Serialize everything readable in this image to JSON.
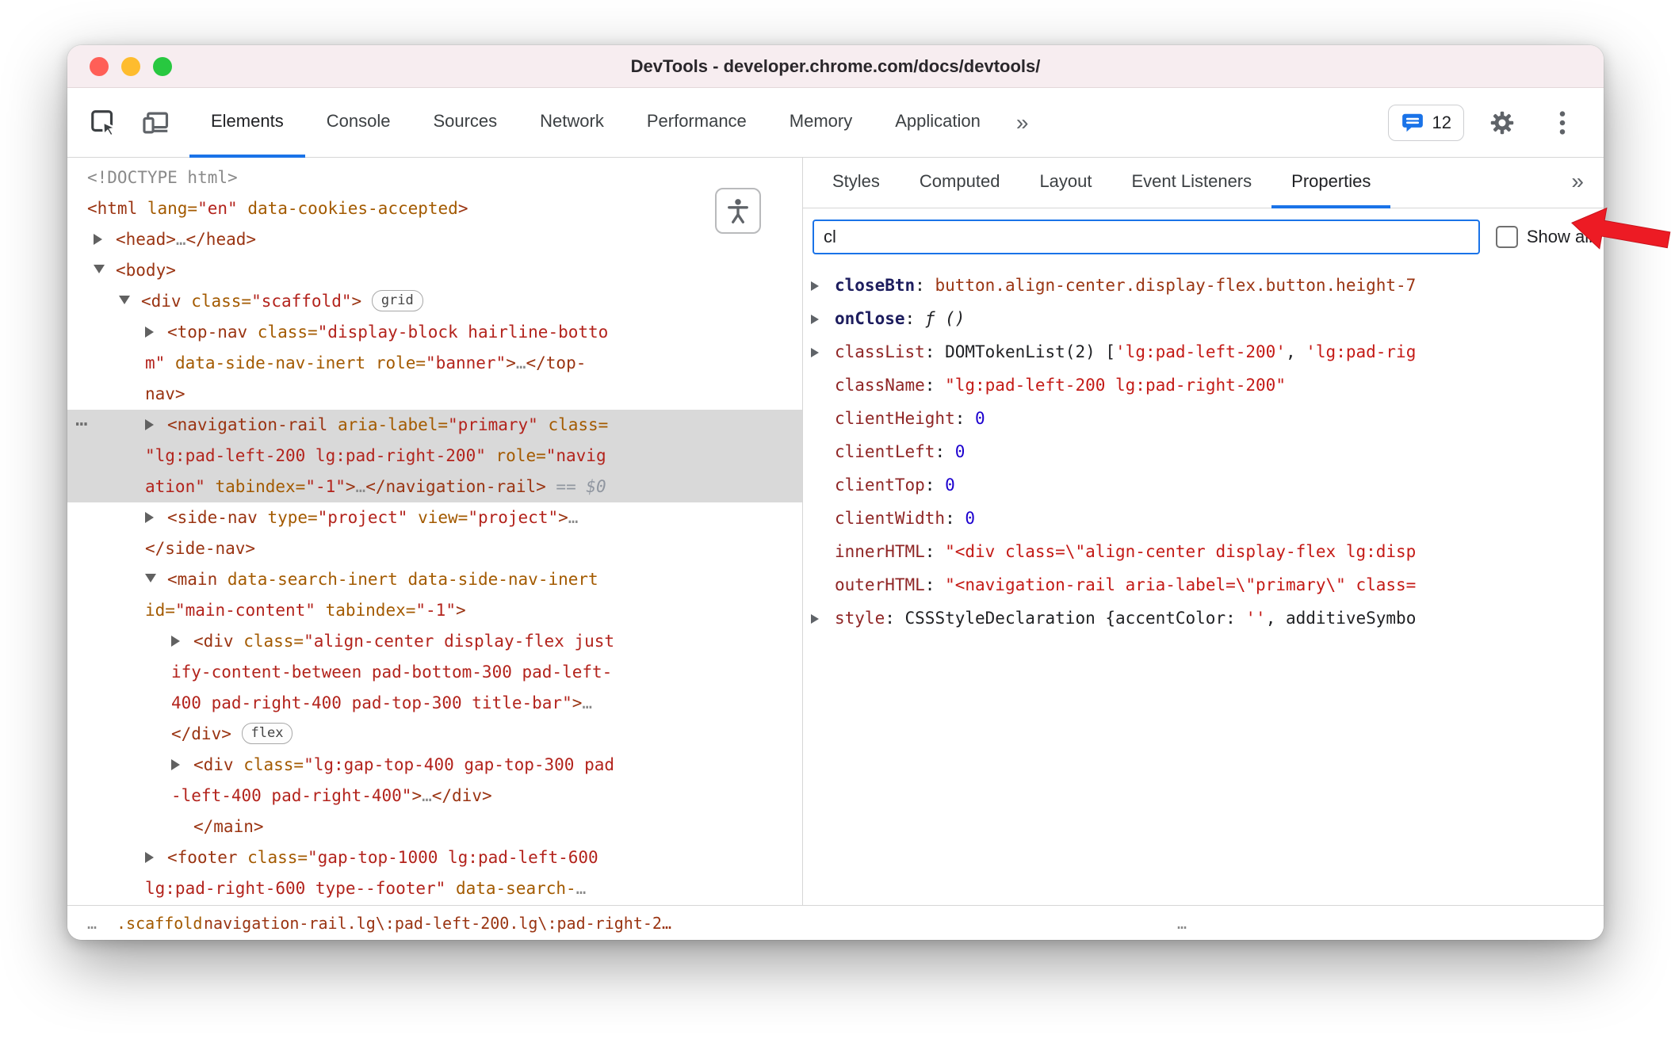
{
  "window": {
    "title": "DevTools - developer.chrome.com/docs/devtools/"
  },
  "toolbar": {
    "tabs": [
      {
        "label": "Elements",
        "selected": true
      },
      {
        "label": "Console",
        "selected": false
      },
      {
        "label": "Sources",
        "selected": false
      },
      {
        "label": "Network",
        "selected": false
      },
      {
        "label": "Performance",
        "selected": false
      },
      {
        "label": "Memory",
        "selected": false
      },
      {
        "label": "Application",
        "selected": false
      }
    ],
    "more_label": "»",
    "issues_count": "12"
  },
  "right_tabs": {
    "tabs": [
      {
        "label": "Styles",
        "selected": false
      },
      {
        "label": "Computed",
        "selected": false
      },
      {
        "label": "Layout",
        "selected": false
      },
      {
        "label": "Event Listeners",
        "selected": false
      },
      {
        "label": "Properties",
        "selected": true
      }
    ],
    "more_label": "»"
  },
  "filter": {
    "value": "cl",
    "show_all_label": "Show all"
  },
  "properties": {
    "rows": [
      {
        "expand": true,
        "own": true,
        "name": "closeBtn",
        "val": [
          {
            "c": "node",
            "t": "button.align-center.display-flex.button.height-7"
          }
        ]
      },
      {
        "expand": true,
        "own": true,
        "name": "onClose",
        "val": [
          {
            "c": "func",
            "t": "ƒ ()"
          }
        ]
      },
      {
        "expand": true,
        "own": false,
        "name": "classList",
        "val": [
          {
            "c": "dark",
            "t": "DOMTokenList(2) ["
          },
          {
            "c": "str",
            "t": "'lg:pad-left-200'"
          },
          {
            "c": "dark",
            "t": ", "
          },
          {
            "c": "str",
            "t": "'lg:pad-rig"
          }
        ]
      },
      {
        "expand": false,
        "own": false,
        "name": "className",
        "val": [
          {
            "c": "str",
            "t": "\"lg:pad-left-200 lg:pad-right-200\""
          }
        ]
      },
      {
        "expand": false,
        "own": false,
        "name": "clientHeight",
        "val": [
          {
            "c": "num",
            "t": "0"
          }
        ]
      },
      {
        "expand": false,
        "own": false,
        "name": "clientLeft",
        "val": [
          {
            "c": "num",
            "t": "0"
          }
        ]
      },
      {
        "expand": false,
        "own": false,
        "name": "clientTop",
        "val": [
          {
            "c": "num",
            "t": "0"
          }
        ]
      },
      {
        "expand": false,
        "own": false,
        "name": "clientWidth",
        "val": [
          {
            "c": "num",
            "t": "0"
          }
        ]
      },
      {
        "expand": false,
        "own": false,
        "name": "innerHTML",
        "val": [
          {
            "c": "str",
            "t": "\"<div class=\\\"align-center display-flex lg:disp"
          }
        ]
      },
      {
        "expand": false,
        "own": false,
        "name": "outerHTML",
        "val": [
          {
            "c": "str",
            "t": "\"<navigation-rail aria-label=\\\"primary\\\" class="
          }
        ]
      },
      {
        "expand": true,
        "own": false,
        "name": "style",
        "val": [
          {
            "c": "dark",
            "t": "CSSStyleDeclaration {accentColor: "
          },
          {
            "c": "str",
            "t": "''"
          },
          {
            "c": "dark",
            "t": ", additiveSymbo"
          }
        ]
      }
    ]
  },
  "dom_tree": {
    "gutter_dots": "…",
    "lines": [
      {
        "lvl": 0,
        "arrow": null,
        "segs": [
          {
            "c": "gray",
            "t": "<!DOCTYPE html>"
          }
        ]
      },
      {
        "lvl": 0,
        "arrow": null,
        "segs": [
          {
            "c": "tag",
            "t": "<html "
          },
          {
            "c": "attr",
            "t": "lang="
          },
          {
            "c": "val",
            "t": "\"en\""
          },
          {
            "c": "plain",
            "t": " "
          },
          {
            "c": "attr",
            "t": "data-cookies-accepted"
          },
          {
            "c": "tag",
            "t": ">"
          }
        ]
      },
      {
        "lvl": 1,
        "arrow": "right",
        "segs": [
          {
            "c": "tag",
            "t": "<head>"
          },
          {
            "c": "gray",
            "t": "…"
          },
          {
            "c": "tag",
            "t": "</head>"
          }
        ]
      },
      {
        "lvl": 1,
        "arrow": "down",
        "segs": [
          {
            "c": "tag",
            "t": "<body>"
          }
        ]
      },
      {
        "lvl": 2,
        "arrow": "down",
        "segs": [
          {
            "c": "tag",
            "t": "<div "
          },
          {
            "c": "attr",
            "t": "class="
          },
          {
            "c": "val",
            "t": "\"scaffold\""
          },
          {
            "c": "tag",
            "t": "> "
          },
          {
            "c": "badge",
            "t": "grid"
          }
        ]
      },
      {
        "lvl": 3,
        "arrow": "right",
        "segs": [
          {
            "c": "tag",
            "t": "<top-nav "
          },
          {
            "c": "attr",
            "t": "class="
          },
          {
            "c": "val",
            "t": "\"display-block hairline-botto\nm\" "
          },
          {
            "c": "attr",
            "t": "data-side-nav-inert"
          },
          {
            "c": "plain",
            "t": " "
          },
          {
            "c": "attr",
            "t": "role="
          },
          {
            "c": "val",
            "t": "\"banner\""
          },
          {
            "c": "tag",
            "t": ">"
          },
          {
            "c": "gray",
            "t": "…"
          },
          {
            "c": "tag",
            "t": "</top-\nnav>"
          }
        ]
      },
      {
        "lvl": 3,
        "arrow": "right",
        "selected": true,
        "gutter": true,
        "segs": [
          {
            "c": "tag",
            "t": "<navigation-rail "
          },
          {
            "c": "attr",
            "t": "aria-label="
          },
          {
            "c": "val",
            "t": "\"primary\" "
          },
          {
            "c": "attr",
            "t": "class=\n"
          },
          {
            "c": "val",
            "t": "\"lg:pad-left-200 lg:pad-right-200\" "
          },
          {
            "c": "attr",
            "t": "role="
          },
          {
            "c": "val",
            "t": "\"navig\nation\" "
          },
          {
            "c": "attr",
            "t": "tabindex="
          },
          {
            "c": "val",
            "t": "\"-1\""
          },
          {
            "c": "tag",
            "t": ">"
          },
          {
            "c": "gray",
            "t": "…"
          },
          {
            "c": "tag",
            "t": "</navigation-rail>"
          },
          {
            "c": "grayi",
            "t": " == $0"
          }
        ]
      },
      {
        "lvl": 3,
        "arrow": "right",
        "segs": [
          {
            "c": "tag",
            "t": "<side-nav "
          },
          {
            "c": "attr",
            "t": "type="
          },
          {
            "c": "val",
            "t": "\"project\" "
          },
          {
            "c": "attr",
            "t": "view="
          },
          {
            "c": "val",
            "t": "\"project\""
          },
          {
            "c": "tag",
            "t": ">"
          },
          {
            "c": "gray",
            "t": "…"
          },
          {
            "c": "tag",
            "t": "\n</side-nav>"
          }
        ]
      },
      {
        "lvl": 3,
        "arrow": "down",
        "segs": [
          {
            "c": "tag",
            "t": "<main "
          },
          {
            "c": "attr",
            "t": "data-search-inert"
          },
          {
            "c": "plain",
            "t": " "
          },
          {
            "c": "attr",
            "t": "data-side-nav-inert\n"
          },
          {
            "c": "attr",
            "t": "id="
          },
          {
            "c": "val",
            "t": "\"main-content\" "
          },
          {
            "c": "attr",
            "t": "tabindex="
          },
          {
            "c": "val",
            "t": "\"-1\""
          },
          {
            "c": "tag",
            "t": ">"
          }
        ]
      },
      {
        "lvl": 4,
        "arrow": "right",
        "segs": [
          {
            "c": "tag",
            "t": "<div "
          },
          {
            "c": "attr",
            "t": "class="
          },
          {
            "c": "val",
            "t": "\"align-center display-flex just\nify-content-between pad-bottom-300 pad-left-\n400 pad-right-400 pad-top-300 title-bar\""
          },
          {
            "c": "tag",
            "t": ">"
          },
          {
            "c": "gray",
            "t": "…"
          },
          {
            "c": "tag",
            "t": "\n</div> "
          },
          {
            "c": "badge",
            "t": "flex"
          }
        ]
      },
      {
        "lvl": 4,
        "arrow": "right",
        "segs": [
          {
            "c": "tag",
            "t": "<div "
          },
          {
            "c": "attr",
            "t": "class="
          },
          {
            "c": "val",
            "t": "\"lg:gap-top-400 gap-top-300 pad\n-left-400 pad-right-400\""
          },
          {
            "c": "tag",
            "t": ">"
          },
          {
            "c": "gray",
            "t": "…"
          },
          {
            "c": "tag",
            "t": "</div>"
          }
        ]
      },
      {
        "lvl": 4,
        "arrow": "space",
        "segs": [
          {
            "c": "tag",
            "t": "</main>"
          }
        ]
      },
      {
        "lvl": 3,
        "arrow": "right",
        "segs": [
          {
            "c": "tag",
            "t": "<footer "
          },
          {
            "c": "attr",
            "t": "class="
          },
          {
            "c": "val",
            "t": "\"gap-top-1000 lg:pad-left-600\nlg:pad-right-600 type--footer\" "
          },
          {
            "c": "attr",
            "t": "data-search-"
          },
          {
            "c": "gray",
            "t": "…"
          }
        ]
      }
    ]
  },
  "breadcrumbs": {
    "items": [
      {
        "t": "…"
      },
      {
        "t": ".scaffold"
      },
      {
        "t": "navigation-rail.lg\\:pad-left-200.lg\\:pad-right-2…"
      },
      {
        "t": "…"
      }
    ]
  },
  "colors": {
    "accent": "#1a73e8",
    "annotation_arrow": "#ed1b24",
    "selection_bg": "#d9d9d9"
  }
}
